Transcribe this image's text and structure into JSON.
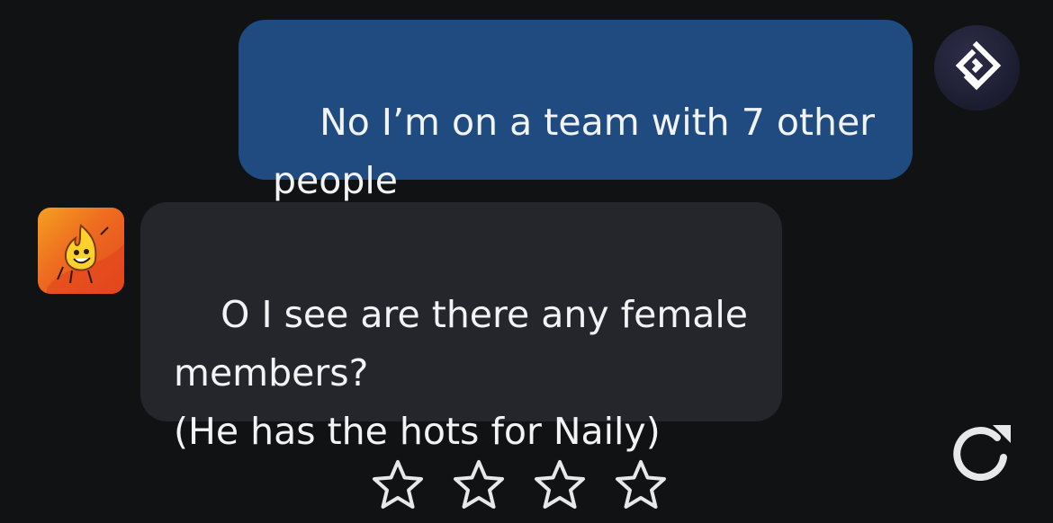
{
  "user_message": {
    "text": "No I’m on a team with 7 other\npeople",
    "avatar_icon": "diamond-logo-icon"
  },
  "bot_message": {
    "text": "O I see are there any female\nmembers?\n(He has the hots for Naily)",
    "avatar_icon": "firey-character-avatar"
  },
  "actions": {
    "regenerate_icon": "refresh-icon"
  },
  "rating": {
    "stars": [
      "star-outline-icon",
      "star-outline-icon",
      "star-outline-icon",
      "star-outline-icon"
    ],
    "value": 0,
    "max": 4
  },
  "colors": {
    "background": "#111214",
    "user_bubble": "#1f4b81",
    "bot_bubble": "#24262b",
    "text": "#f2f3f5",
    "icon": "#e8e8ea"
  }
}
